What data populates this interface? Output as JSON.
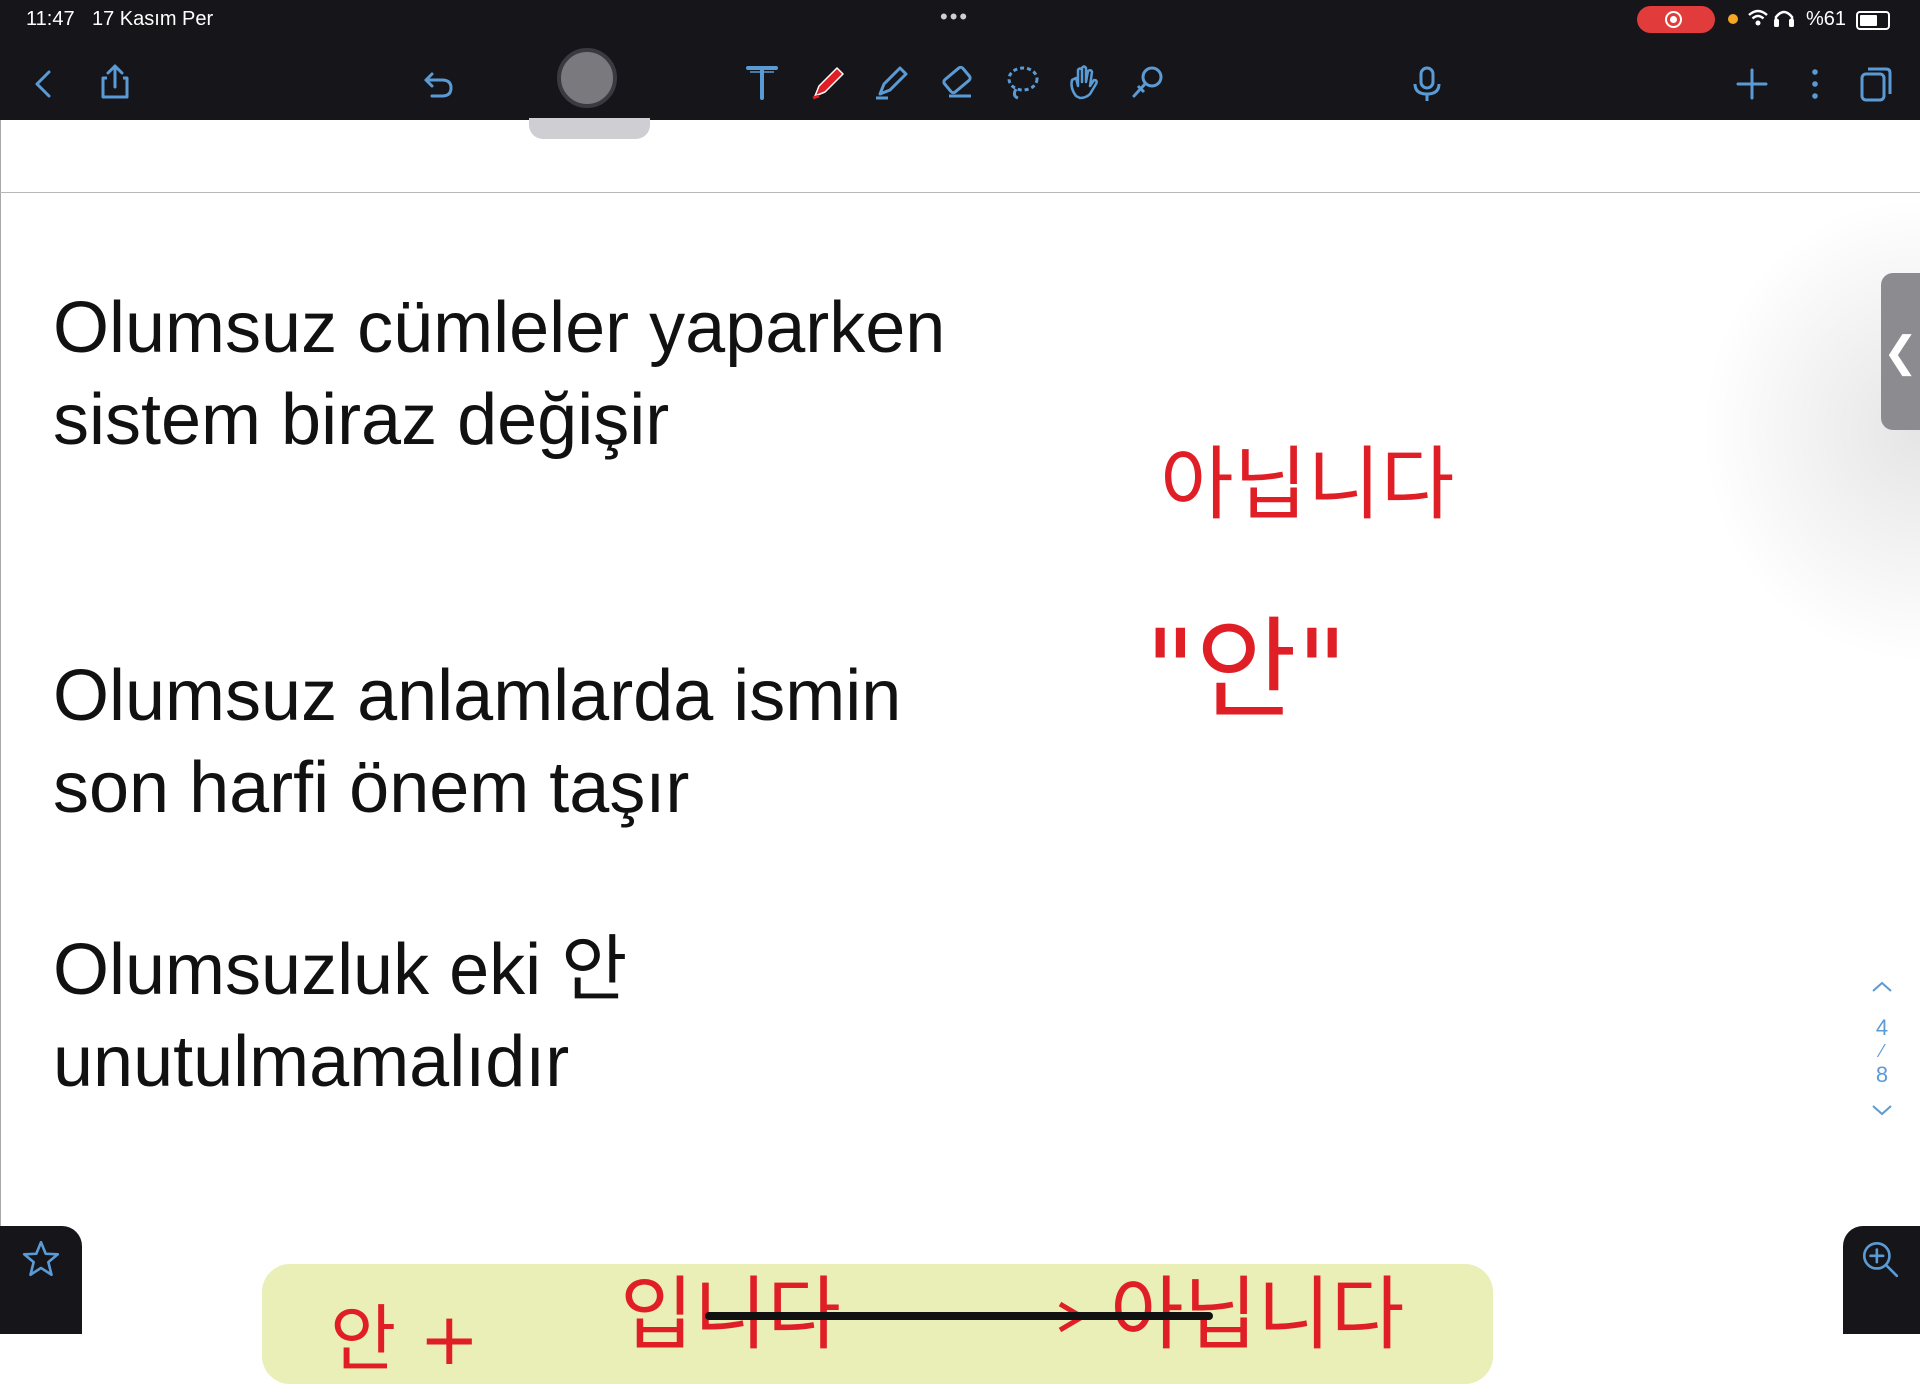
{
  "status_bar": {
    "time": "11:47",
    "date": "17 Kasım Per",
    "dots": "•••",
    "battery_text": "%61",
    "icons": "📶 🎧"
  },
  "toolbar": {
    "items": [
      "back-icon",
      "share-icon",
      "undo-icon",
      "text-icon",
      "pen-icon",
      "highlighter-icon",
      "eraser-icon",
      "lasso-icon",
      "hand-icon",
      "magic-icon",
      "mic-icon",
      "add-icon",
      "more-icon",
      "pages-icon"
    ],
    "accent": "#5b9bd5",
    "pen_color": "#e01e26"
  },
  "note": {
    "line1a": "Olumsuz cümleler yaparken",
    "line1b": "sistem biraz değişir",
    "line2a": "Olumsuz anlamlarda ismin",
    "line2b": "son harfi önem taşır",
    "line3a": "Olumsuzluk eki 안",
    "line3b": "unutulmamalıdır"
  },
  "annotations": {
    "anipnida": "아닙니다",
    "an_quote": "\"안\"",
    "bottom_left": "안 +",
    "bottom_mid": "입니다",
    "bottom_right": "아닙니다"
  },
  "pager": {
    "current": "4",
    "separator": "⁄",
    "total": "8"
  },
  "side_handle": "❮"
}
